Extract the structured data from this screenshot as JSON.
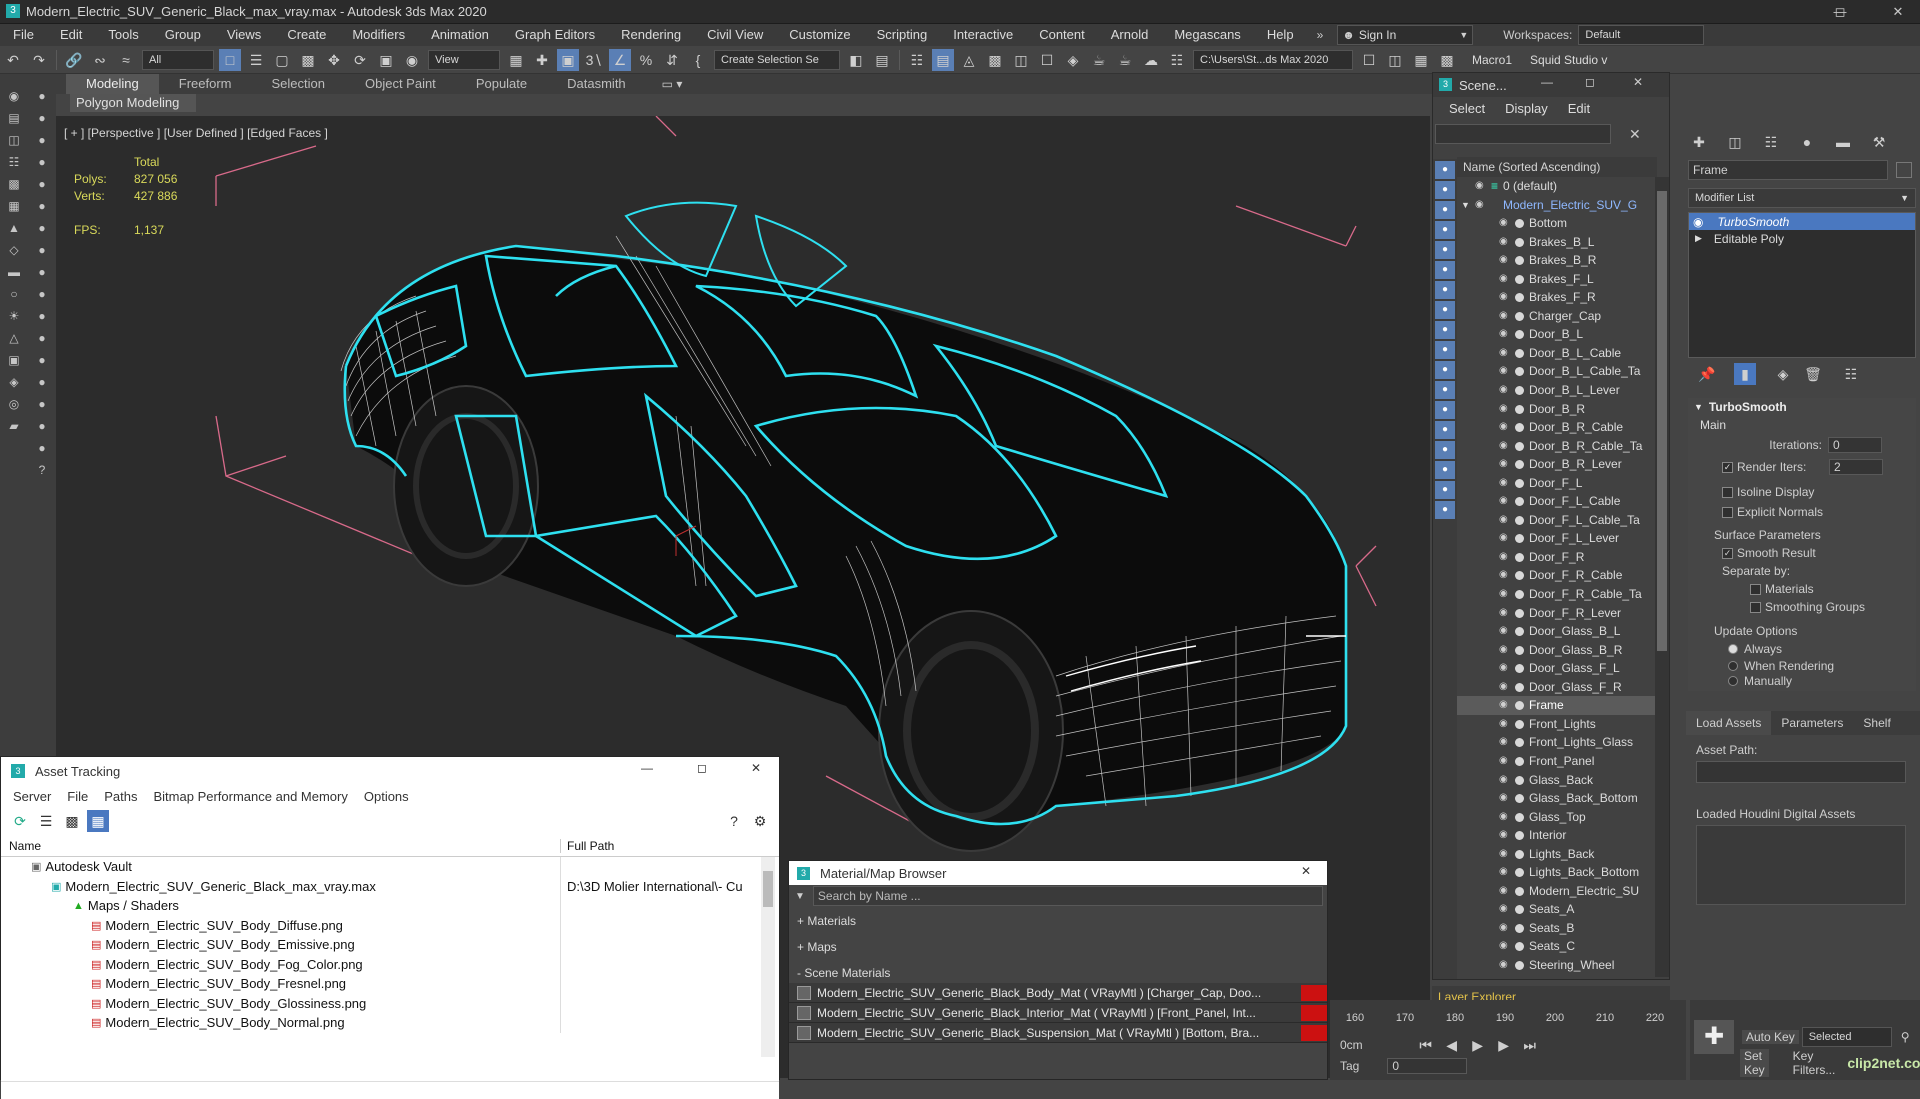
{
  "window": {
    "title": "Modern_Electric_SUV_Generic_Black_max_vray.max - Autodesk 3ds Max 2020",
    "sign_in": "Sign In",
    "workspaces_label": "Workspaces:",
    "workspace_value": "Default"
  },
  "menu": [
    "File",
    "Edit",
    "Tools",
    "Group",
    "Views",
    "Create",
    "Modifiers",
    "Animation",
    "Graph Editors",
    "Rendering",
    "Civil View",
    "Customize",
    "Scripting",
    "Interactive",
    "Content",
    "Arnold",
    "Megascans",
    "Help"
  ],
  "toolbar": {
    "filter_value": "All",
    "ref_coord": "View",
    "selection_set": "Create Selection Se",
    "path": "C:\\Users\\St...ds Max 2020",
    "macro": "Macro1",
    "plugin": "Squid Studio v"
  },
  "ribbon": {
    "tabs": [
      "Modeling",
      "Freeform",
      "Selection",
      "Object Paint",
      "Populate",
      "Datasmith"
    ],
    "active": "Modeling",
    "sub": "Polygon Modeling"
  },
  "viewport": {
    "label": "[ + ] [Perspective ] [User Defined ] [Edged Faces ]",
    "stats_header": "Total",
    "polys_label": "Polys:",
    "polys": "827 056",
    "verts_label": "Verts:",
    "verts": "427 886",
    "fps_label": "FPS:",
    "fps": "1,137"
  },
  "scene_explorer": {
    "title": "Scene...",
    "menu": [
      "Select",
      "Display",
      "Edit"
    ],
    "column": "Name (Sorted Ascending)",
    "layer_default": "0 (default)",
    "root": "Modern_Electric_SUV_G",
    "items": [
      "Bottom",
      "Brakes_B_L",
      "Brakes_B_R",
      "Brakes_F_L",
      "Brakes_F_R",
      "Charger_Cap",
      "Door_B_L",
      "Door_B_L_Cable",
      "Door_B_L_Cable_Ta",
      "Door_B_L_Lever",
      "Door_B_R",
      "Door_B_R_Cable",
      "Door_B_R_Cable_Ta",
      "Door_B_R_Lever",
      "Door_F_L",
      "Door_F_L_Cable",
      "Door_F_L_Cable_Ta",
      "Door_F_L_Lever",
      "Door_F_R",
      "Door_F_R_Cable",
      "Door_F_R_Cable_Ta",
      "Door_F_R_Lever",
      "Door_Glass_B_L",
      "Door_Glass_B_R",
      "Door_Glass_F_L",
      "Door_Glass_F_R",
      "Frame",
      "Front_Lights",
      "Front_Lights_Glass",
      "Front_Panel",
      "Glass_Back",
      "Glass_Back_Bottom",
      "Glass_Top",
      "Interior",
      "Lights_Back",
      "Lights_Back_Bottom",
      "Modern_Electric_SU",
      "Seats_A",
      "Seats_B",
      "Seats_C",
      "Steering_Wheel"
    ],
    "selected": "Frame",
    "layer_explorer": "Layer Explorer"
  },
  "command_panel": {
    "object_name": "Frame",
    "modifier_list": "Modifier List",
    "stack": [
      "TurboSmooth",
      "Editable Poly"
    ],
    "rollout": "TurboSmooth",
    "main": "Main",
    "iterations_label": "Iterations:",
    "iterations": "0",
    "render_iters_label": "Render Iters:",
    "render_iters": "2",
    "isoline": "Isoline Display",
    "explicit_normals": "Explicit Normals",
    "surface_params": "Surface Parameters",
    "smooth_result": "Smooth Result",
    "separate_by": "Separate by:",
    "materials": "Materials",
    "smoothing_groups": "Smoothing Groups",
    "update_options": "Update Options",
    "always": "Always",
    "when_rendering": "When Rendering",
    "manually": "Manually",
    "tabs": [
      "Load Assets",
      "Parameters",
      "Shelf"
    ],
    "asset_path": "Asset Path:",
    "loaded_hda": "Loaded Houdini Digital Assets"
  },
  "asset_tracking": {
    "title": "Asset Tracking",
    "menu": [
      "Server",
      "File",
      "Paths",
      "Bitmap Performance and Memory",
      "Options"
    ],
    "col_name": "Name",
    "col_path": "Full Path",
    "vault": "Autodesk Vault",
    "file": "Modern_Electric_SUV_Generic_Black_max_vray.max",
    "file_path": "D:\\3D Molier International\\- Cu",
    "maps": "Maps / Shaders",
    "bitmaps": [
      "Modern_Electric_SUV_Body_Diffuse.png",
      "Modern_Electric_SUV_Body_Emissive.png",
      "Modern_Electric_SUV_Body_Fog_Color.png",
      "Modern_Electric_SUV_Body_Fresnel.png",
      "Modern_Electric_SUV_Body_Glossiness.png",
      "Modern_Electric_SUV_Body_Normal.png"
    ]
  },
  "material_browser": {
    "title": "Material/Map Browser",
    "search": "Search by Name ...",
    "sections": [
      "+ Materials",
      "+ Maps",
      "- Scene Materials"
    ],
    "materials": [
      "Modern_Electric_SUV_Generic_Black_Body_Mat ( VRayMtl ) [Charger_Cap, Doo...",
      "Modern_Electric_SUV_Generic_Black_Interior_Mat ( VRayMtl ) [Front_Panel, Int...",
      "Modern_Electric_SUV_Generic_Black_Suspension_Mat ( VRayMtl ) [Bottom, Bra..."
    ]
  },
  "timeline": {
    "ticks": [
      "160",
      "170",
      "180",
      "190",
      "200",
      "210",
      "220"
    ],
    "frame": "0",
    "auto_key": "Auto Key",
    "set_key": "Set Key",
    "selected": "Selected",
    "key_filters": "Key Filters...",
    "left_label_1": "0cm",
    "left_label_2": "Tag",
    "watermark": "clip2net.com"
  },
  "colors": {
    "selection_outline": "#2ee0f0",
    "wire": "#ffffff",
    "accent_blue": "#4a78c0"
  }
}
